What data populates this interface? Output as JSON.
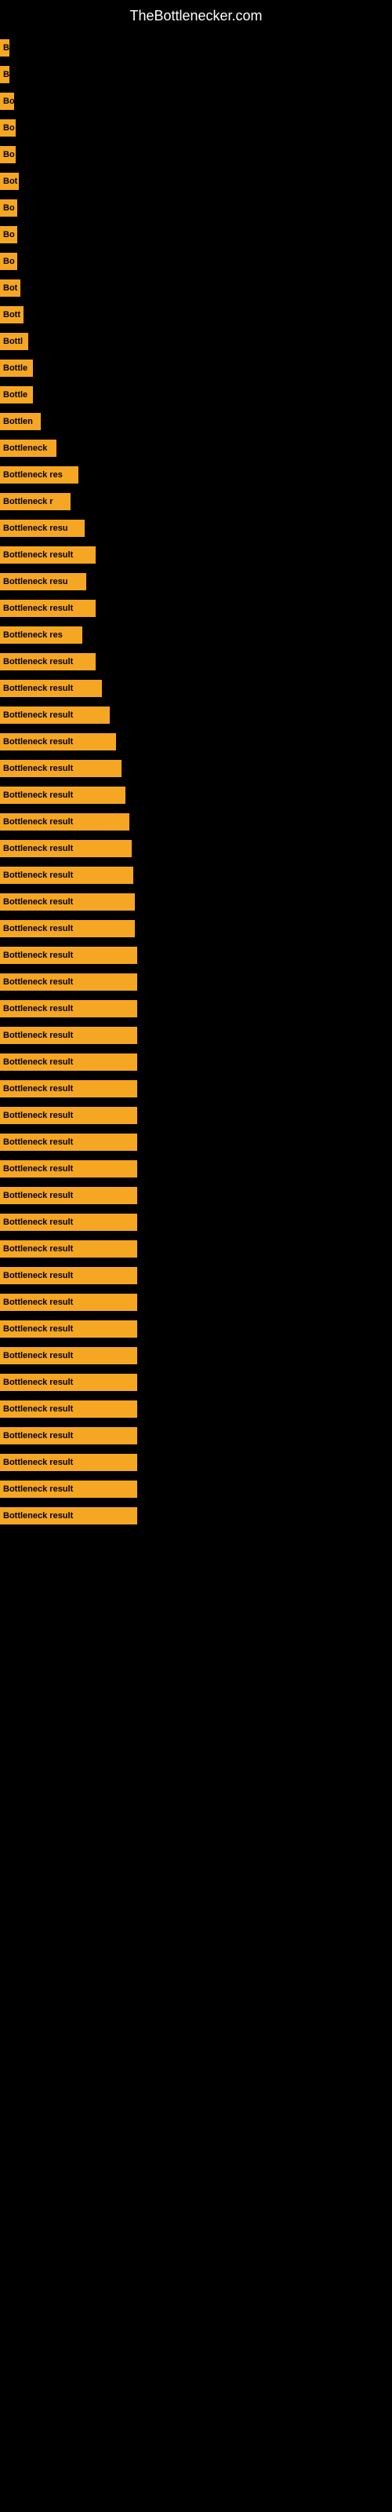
{
  "site": {
    "title": "TheBottlenecker.com"
  },
  "bars": [
    {
      "label": "B",
      "width": 12
    },
    {
      "label": "B",
      "width": 12
    },
    {
      "label": "Bo",
      "width": 18
    },
    {
      "label": "Bo",
      "width": 20
    },
    {
      "label": "Bo",
      "width": 20
    },
    {
      "label": "Bot",
      "width": 24
    },
    {
      "label": "Bo",
      "width": 22
    },
    {
      "label": "Bo",
      "width": 22
    },
    {
      "label": "Bo",
      "width": 22
    },
    {
      "label": "Bot",
      "width": 26
    },
    {
      "label": "Bott",
      "width": 30
    },
    {
      "label": "Bottl",
      "width": 36
    },
    {
      "label": "Bottle",
      "width": 42
    },
    {
      "label": "Bottle",
      "width": 42
    },
    {
      "label": "Bottlen",
      "width": 52
    },
    {
      "label": "Bottleneck",
      "width": 72
    },
    {
      "label": "Bottleneck res",
      "width": 100
    },
    {
      "label": "Bottleneck r",
      "width": 90
    },
    {
      "label": "Bottleneck resu",
      "width": 108
    },
    {
      "label": "Bottleneck result",
      "width": 122
    },
    {
      "label": "Bottleneck resu",
      "width": 110
    },
    {
      "label": "Bottleneck result",
      "width": 122
    },
    {
      "label": "Bottleneck res",
      "width": 105
    },
    {
      "label": "Bottleneck result",
      "width": 122
    },
    {
      "label": "Bottleneck result",
      "width": 130
    },
    {
      "label": "Bottleneck result",
      "width": 140
    },
    {
      "label": "Bottleneck result",
      "width": 148
    },
    {
      "label": "Bottleneck result",
      "width": 155
    },
    {
      "label": "Bottleneck result",
      "width": 160
    },
    {
      "label": "Bottleneck result",
      "width": 165
    },
    {
      "label": "Bottleneck result",
      "width": 168
    },
    {
      "label": "Bottleneck result",
      "width": 170
    },
    {
      "label": "Bottleneck result",
      "width": 172
    },
    {
      "label": "Bottleneck result",
      "width": 172
    },
    {
      "label": "Bottleneck result",
      "width": 175
    },
    {
      "label": "Bottleneck result",
      "width": 175
    },
    {
      "label": "Bottleneck result",
      "width": 175
    },
    {
      "label": "Bottleneck result",
      "width": 175
    },
    {
      "label": "Bottleneck result",
      "width": 175
    },
    {
      "label": "Bottleneck result",
      "width": 175
    },
    {
      "label": "Bottleneck result",
      "width": 175
    },
    {
      "label": "Bottleneck result",
      "width": 175
    },
    {
      "label": "Bottleneck result",
      "width": 175
    },
    {
      "label": "Bottleneck result",
      "width": 175
    },
    {
      "label": "Bottleneck result",
      "width": 175
    },
    {
      "label": "Bottleneck result",
      "width": 175
    },
    {
      "label": "Bottleneck result",
      "width": 175
    },
    {
      "label": "Bottleneck result",
      "width": 175
    },
    {
      "label": "Bottleneck result",
      "width": 175
    },
    {
      "label": "Bottleneck result",
      "width": 175
    },
    {
      "label": "Bottleneck result",
      "width": 175
    },
    {
      "label": "Bottleneck result",
      "width": 175
    },
    {
      "label": "Bottleneck result",
      "width": 175
    },
    {
      "label": "Bottleneck result",
      "width": 175
    },
    {
      "label": "Bottleneck result",
      "width": 175
    },
    {
      "label": "Bottleneck result",
      "width": 175
    }
  ]
}
